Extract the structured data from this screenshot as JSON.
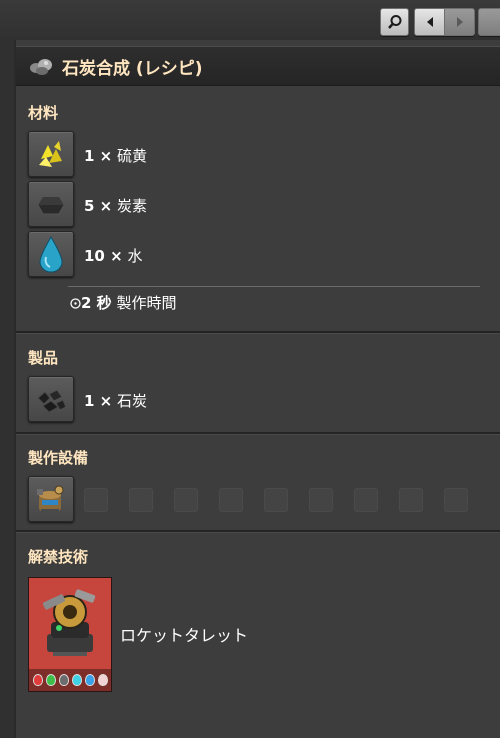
{
  "title": "石炭合成 (レシピ)",
  "colors": {
    "section_title": "#ffe6c0",
    "panel": "#3d3d3d",
    "tech_card": "#c6453d"
  },
  "toolbar": {
    "search_icon": "search-icon",
    "prev_icon": "arrow-left-icon",
    "next_icon": "arrow-right-icon"
  },
  "sections": {
    "ingredients": {
      "title": "材料",
      "items": [
        {
          "count": "1 ×",
          "name": "硫黄",
          "icon": "sulfur-icon"
        },
        {
          "count": "5 ×",
          "name": "炭素",
          "icon": "carbon-icon"
        },
        {
          "count": "10 ×",
          "name": "水",
          "icon": "water-icon"
        }
      ],
      "time": {
        "value": "2 秒",
        "label": "製作時間",
        "icon": "clock-icon"
      }
    },
    "products": {
      "title": "製品",
      "items": [
        {
          "count": "1 ×",
          "name": "石炭",
          "icon": "coal-icon"
        }
      ]
    },
    "machines": {
      "title": "製作設備",
      "icon": "chemical-plant-icon"
    },
    "unlock": {
      "title": "解禁技術",
      "tech_name": "ロケットタレット",
      "icon": "rocket-turret-icon"
    }
  }
}
